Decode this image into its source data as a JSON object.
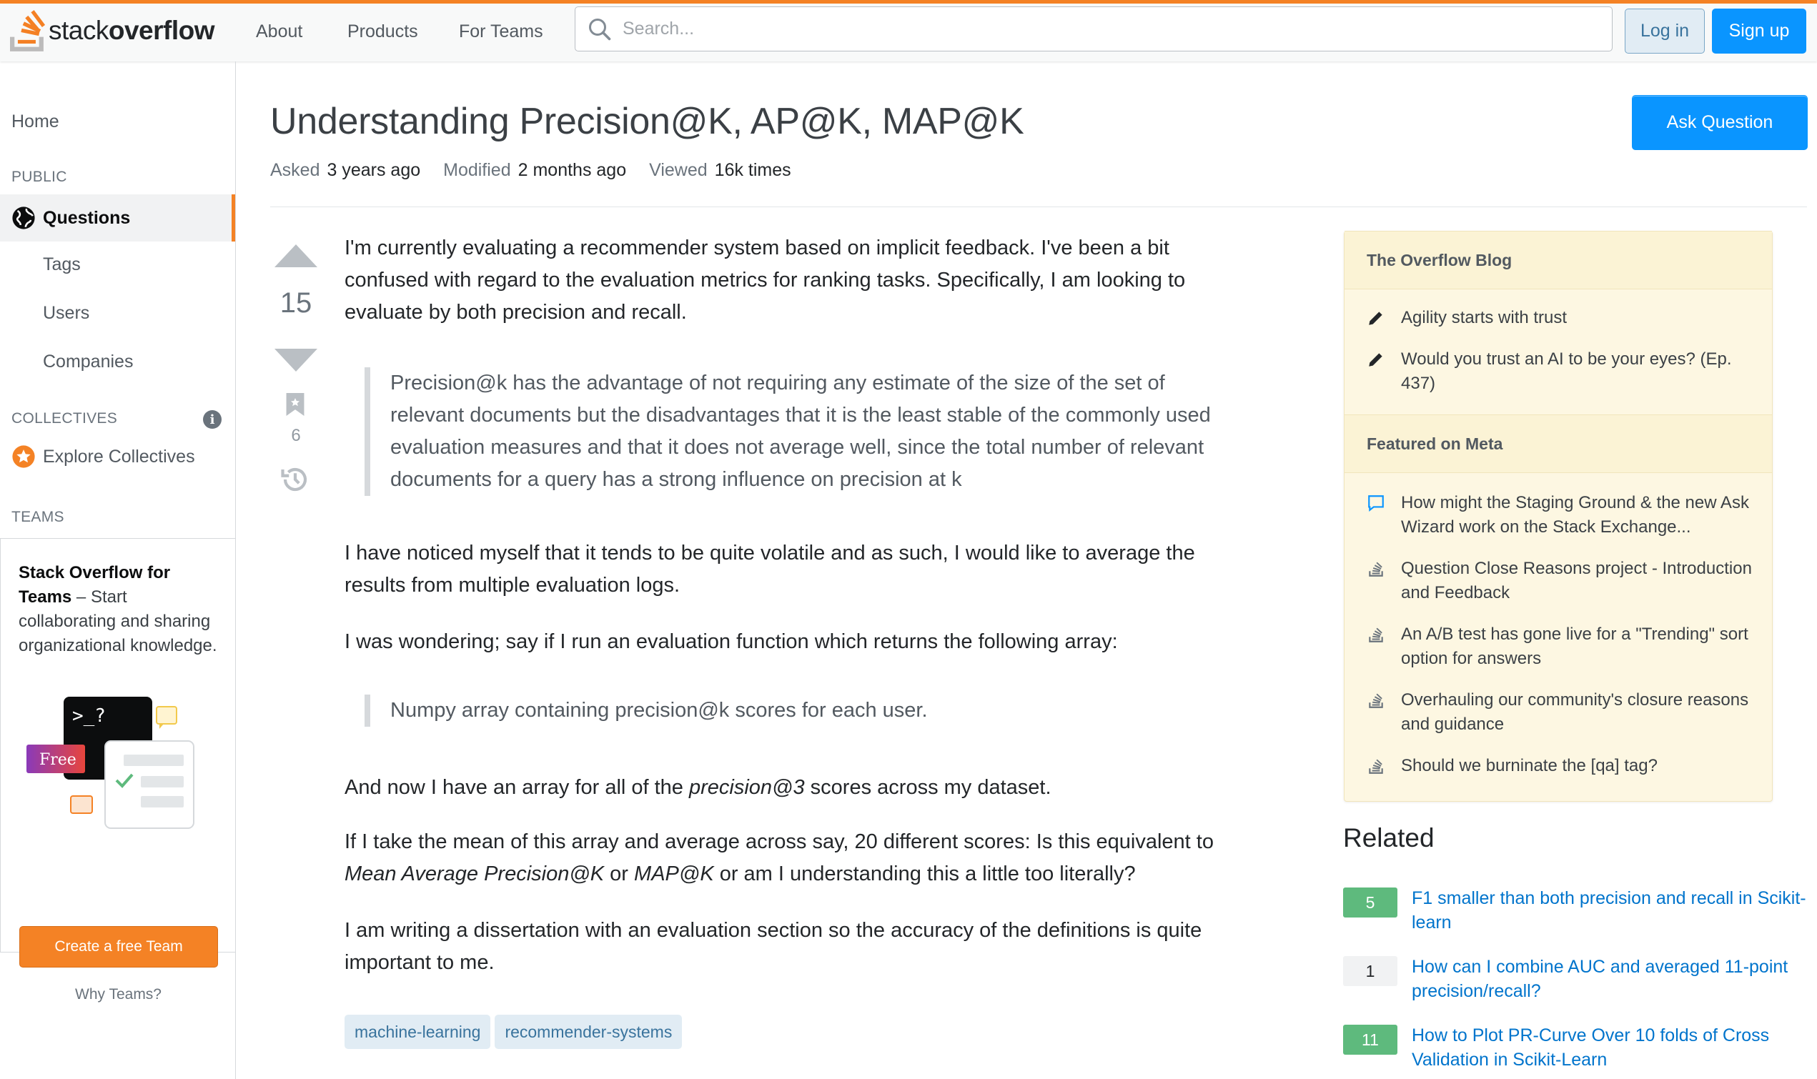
{
  "header": {
    "logo_light": "stack",
    "logo_bold": "overflow",
    "nav": [
      "About",
      "Products",
      "For Teams"
    ],
    "search_placeholder": "Search...",
    "login_label": "Log in",
    "signup_label": "Sign up",
    "accent_color": "#f48225",
    "brand_blue": "#0a95ff"
  },
  "sidebar": {
    "home": "Home",
    "public_heading": "PUBLIC",
    "questions": "Questions",
    "tags": "Tags",
    "users": "Users",
    "companies": "Companies",
    "collectives_heading": "COLLECTIVES",
    "explore_collectives": "Explore Collectives",
    "teams_heading": "TEAMS",
    "teams_title": "Stack Overflow for Teams",
    "teams_desc": " – Start collaborating and sharing organizational knowledge.",
    "teams_prompt_glyph": ">_?",
    "teams_free_badge": "Free",
    "create_team_label": "Create a free Team",
    "why_teams": "Why Teams?"
  },
  "question": {
    "title": "Understanding Precision@K, AP@K, MAP@K",
    "ask_label": "Ask Question",
    "asked_label": "Asked",
    "asked_value": "3 years ago",
    "modified_label": "Modified",
    "modified_value": "2 months ago",
    "viewed_label": "Viewed",
    "viewed_value": "16k times",
    "score": "15",
    "bookmarks": "6",
    "p1": "I'm currently evaluating a recommender system based on implicit feedback. I've been a bit confused with regard to the evaluation metrics for ranking tasks. Specifically, I am looking to evaluate by both precision and recall.",
    "quote1": "Precision@k has the advantage of not requiring any estimate of the size of the set of relevant documents but the disadvantages that it is the least stable of the commonly used evaluation measures and that it does not average well, since the total number of relevant documents for a query has a strong influence on precision at k",
    "p2": "I have noticed myself that it tends to be quite volatile and as such, I would like to average the results from multiple evaluation logs.",
    "p3": "I was wondering; say if I run an evaluation function which returns the following array:",
    "quote2": "Numpy array containing precision@k scores for each user.",
    "p4_pre": "And now I have an array for all of the ",
    "p4_em": "precision@3",
    "p4_post": " scores across my dataset.",
    "p5_pre": "If I take the mean of this array and average across say, 20 different scores: Is this equivalent to ",
    "p5_em1": "Mean Average Precision@K",
    "p5_mid": " or ",
    "p5_em2": "MAP@K",
    "p5_post": " or am I understanding this a little too literally?",
    "p6": "I am writing a dissertation with an evaluation section so the accuracy of the definitions is quite important to me.",
    "tags": [
      "machine-learning",
      "recommender-systems"
    ]
  },
  "blog": {
    "heading": "The Overflow Blog",
    "items": [
      {
        "icon": "pencil-icon",
        "text": "Agility starts with trust"
      },
      {
        "icon": "pencil-icon",
        "text": "Would you trust an AI to be your eyes? (Ep. 437)"
      }
    ],
    "meta_heading": "Featured on Meta",
    "meta_items": [
      {
        "icon": "chat-bubble-icon",
        "text": "How might the Staging Ground & the new Ask Wizard work on the Stack Exchange..."
      },
      {
        "icon": "stack-icon",
        "text": "Question Close Reasons project - Introduction and Feedback"
      },
      {
        "icon": "stack-icon",
        "text": "An A/B test has gone live for a \"Trending\" sort option for answers"
      },
      {
        "icon": "stack-icon",
        "text": "Overhauling our community's closure reasons and guidance"
      },
      {
        "icon": "stack-icon",
        "text": "Should we burninate the [qa] tag?"
      }
    ]
  },
  "related": {
    "heading": "Related",
    "items": [
      {
        "score": "5",
        "accepted": true,
        "text": "F1 smaller than both precision and recall in Scikit-learn"
      },
      {
        "score": "1",
        "accepted": false,
        "text": "How can I combine AUC and averaged 11-point precision/recall?"
      },
      {
        "score": "11",
        "accepted": true,
        "text": "How to Plot PR-Curve Over 10 folds of Cross Validation in Scikit-Learn"
      }
    ]
  }
}
